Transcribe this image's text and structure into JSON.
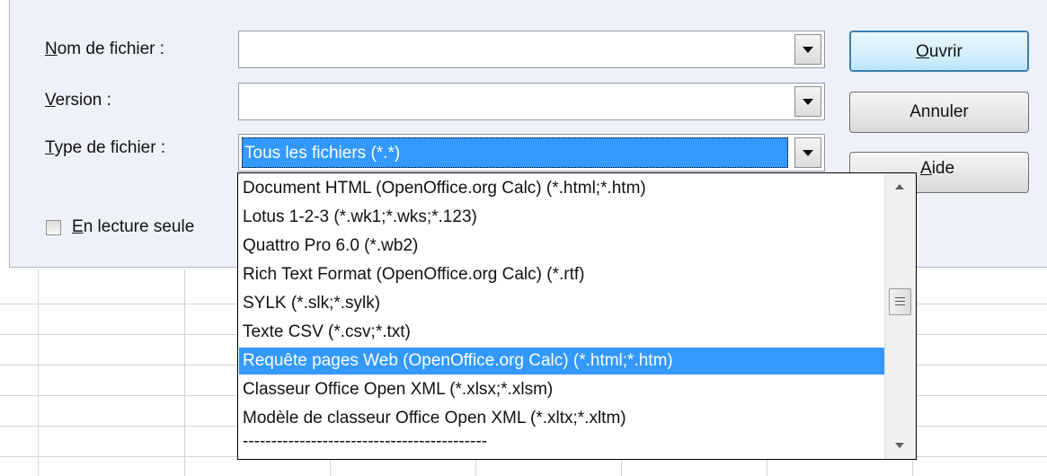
{
  "form": {
    "nom_label_key": "N",
    "nom_label_rest": "om de fichier :",
    "version_label_key": "V",
    "version_label_rest": "ersion :",
    "type_label_key": "T",
    "type_label_rest": "ype de fichier :",
    "nom_value": "",
    "version_value": "",
    "type_value": "Tous les fichiers (*.*)",
    "readonly_key": "E",
    "readonly_rest": "n lecture seule"
  },
  "buttons": {
    "open_key": "O",
    "open_rest": "uvrir",
    "cancel": "Annuler",
    "help_key": "A",
    "help_rest": "ide"
  },
  "dropdown": {
    "items": [
      "Document HTML (OpenOffice.org Calc) (*.html;*.htm)",
      "Lotus 1-2-3 (*.wk1;*.wks;*.123)",
      "Quattro Pro 6.0 (*.wb2)",
      "Rich Text Format (OpenOffice.org Calc) (*.rtf)",
      "SYLK (*.slk;*.sylk)",
      "Texte CSV (*.csv;*.txt)",
      "Requête pages Web (OpenOffice.org Calc) (*.html;*.htm)",
      "Classeur Office Open XML (*.xlsx;*.xlsm)",
      "Modèle de classeur Office Open XML (*.xltx;*.xltm)",
      "-------------------------------------------"
    ],
    "selected_index": 6
  },
  "colors": {
    "selection": "#3399ff",
    "dialog_bg": "#eef2f8"
  }
}
